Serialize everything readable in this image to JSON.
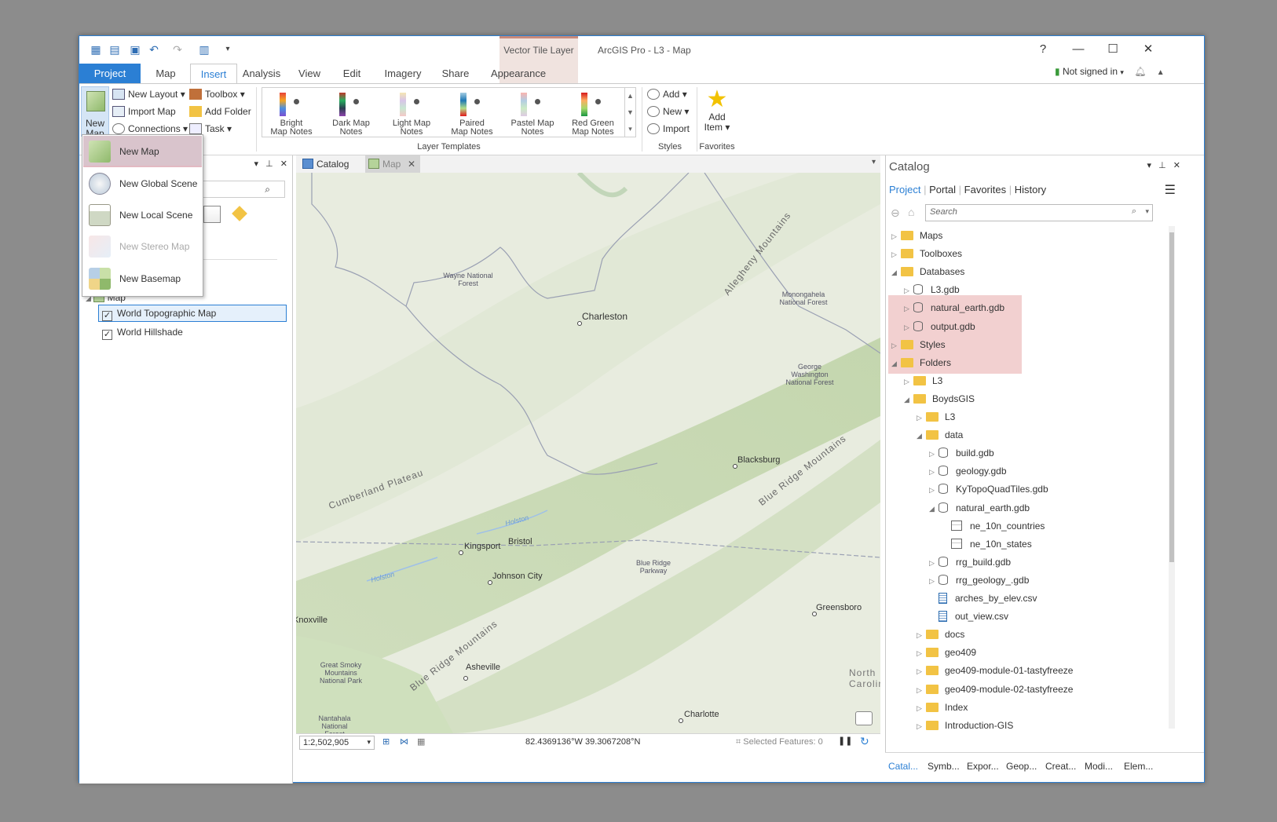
{
  "window": {
    "app_title": "ArcGIS Pro - L3 - Map",
    "context_tab_title": "Vector Tile Layer",
    "help": "?",
    "signin": "Not signed in"
  },
  "ribbon_tabs": [
    "Project",
    "Map",
    "Insert",
    "Analysis",
    "View",
    "Edit",
    "Imagery",
    "Share",
    "Appearance"
  ],
  "ribbon": {
    "new_map_label": "New Map",
    "new_layout": "New Layout",
    "import_map": "Import Map",
    "connections": "Connections",
    "toolbox": "Toolbox",
    "add_folder": "Add Folder",
    "task": "Task",
    "layer_templates": [
      {
        "label1": "Bright",
        "label2": "Map Notes"
      },
      {
        "label1": "Dark Map",
        "label2": "Notes"
      },
      {
        "label1": "Light Map",
        "label2": "Notes"
      },
      {
        "label1": "Paired",
        "label2": "Map Notes"
      },
      {
        "label1": "Pastel Map",
        "label2": "Notes"
      },
      {
        "label1": "Red Green",
        "label2": "Map Notes"
      }
    ],
    "layer_templates_group": "Layer Templates",
    "styles_add": "Add",
    "styles_new": "New",
    "styles_import": "Import",
    "styles_group": "Styles",
    "add_item_1": "Add",
    "add_item_2": "Item",
    "favorites_group": "Favorites"
  },
  "new_map_menu": [
    "New Map",
    "New Global Scene",
    "New Local Scene",
    "New Stereo Map",
    "New Basemap"
  ],
  "contents": {
    "map_label": "Map",
    "layers": [
      "World Topographic Map",
      "World Hillshade"
    ]
  },
  "view_tabs": [
    "Catalog",
    "Map"
  ],
  "map_labels": {
    "charleston": "Charleston",
    "wayne": "Wayne National Forest",
    "allegheny": "Allegheny Mountains",
    "monongahela": "Monongahela National Forest",
    "gw": "George Washington National Forest",
    "cumberland": "Cumberland Plateau",
    "blacksburg": "Blacksburg",
    "blueridge_mtns": "Blue Ridge Mountains",
    "holston1": "Holston",
    "holston2": "Holston",
    "kingsport": "Kingsport",
    "bristol": "Bristol",
    "johnson": "Johnson City",
    "brparkway": "Blue Ridge Parkway",
    "knoxville": "Knoxville",
    "greensboro": "Greensboro",
    "greatsmoky": "Great Smoky Mountains National Park",
    "blueridge2": "Blue Ridge Mountains",
    "asheville": "Asheville",
    "northcarolina": "North Carolina",
    "nantahala": "Nantahala National Forest",
    "charlotte": "Charlotte"
  },
  "status": {
    "scale": "1:2,502,905",
    "coords": "82.4369136°W 39.3067208°N",
    "selected": "Selected Features: 0"
  },
  "catalog": {
    "title": "Catalog",
    "tabs": [
      "Project",
      "Portal",
      "Favorites",
      "History"
    ],
    "search_placeholder": "Search",
    "items": [
      {
        "label": "Maps",
        "indent": 0,
        "exp": "▷",
        "icon": "folder"
      },
      {
        "label": "Toolboxes",
        "indent": 0,
        "exp": "▷",
        "icon": "folder"
      },
      {
        "label": "Databases",
        "indent": 0,
        "exp": "◢",
        "icon": "folder"
      },
      {
        "label": "L3.gdb",
        "indent": 1,
        "exp": "▷",
        "icon": "db"
      },
      {
        "label": "natural_earth.gdb",
        "indent": 1,
        "exp": "▷",
        "icon": "db"
      },
      {
        "label": "output.gdb",
        "indent": 1,
        "exp": "▷",
        "icon": "db"
      },
      {
        "label": "Styles",
        "indent": 0,
        "exp": "▷",
        "icon": "folder"
      },
      {
        "label": "Folders",
        "indent": 0,
        "exp": "◢",
        "icon": "folder"
      },
      {
        "label": "L3",
        "indent": 1,
        "exp": "▷",
        "icon": "folder"
      },
      {
        "label": "BoydsGIS",
        "indent": 1,
        "exp": "◢",
        "icon": "folder"
      },
      {
        "label": "L3",
        "indent": 2,
        "exp": "▷",
        "icon": "folder"
      },
      {
        "label": "data",
        "indent": 2,
        "exp": "◢",
        "icon": "folder"
      },
      {
        "label": "build.gdb",
        "indent": 3,
        "exp": "▷",
        "icon": "db"
      },
      {
        "label": "geology.gdb",
        "indent": 3,
        "exp": "▷",
        "icon": "db"
      },
      {
        "label": "KyTopoQuadTiles.gdb",
        "indent": 3,
        "exp": "▷",
        "icon": "db"
      },
      {
        "label": "natural_earth.gdb",
        "indent": 3,
        "exp": "◢",
        "icon": "db"
      },
      {
        "label": "ne_10n_countries",
        "indent": 4,
        "exp": "",
        "icon": "fc"
      },
      {
        "label": "ne_10n_states",
        "indent": 4,
        "exp": "",
        "icon": "fc"
      },
      {
        "label": "rrg_build.gdb",
        "indent": 3,
        "exp": "▷",
        "icon": "db"
      },
      {
        "label": "rrg_geology_.gdb",
        "indent": 3,
        "exp": "▷",
        "icon": "db"
      },
      {
        "label": "arches_by_elev.csv",
        "indent": 3,
        "exp": "",
        "icon": "csv"
      },
      {
        "label": "out_view.csv",
        "indent": 3,
        "exp": "",
        "icon": "csv"
      },
      {
        "label": "docs",
        "indent": 2,
        "exp": "▷",
        "icon": "folder"
      },
      {
        "label": "geo409",
        "indent": 2,
        "exp": "▷",
        "icon": "folder"
      },
      {
        "label": "geo409-module-01-tastyfreeze",
        "indent": 2,
        "exp": "▷",
        "icon": "folder"
      },
      {
        "label": "geo409-module-02-tastyfreeze",
        "indent": 2,
        "exp": "▷",
        "icon": "folder"
      },
      {
        "label": "Index",
        "indent": 2,
        "exp": "▷",
        "icon": "folder"
      },
      {
        "label": "Introduction-GIS",
        "indent": 2,
        "exp": "▷",
        "icon": "folder"
      }
    ]
  },
  "bottom_tabs": [
    "Catal...",
    "Symb...",
    "Expor...",
    "Geop...",
    "Creat...",
    "Modi...",
    "Elem..."
  ]
}
